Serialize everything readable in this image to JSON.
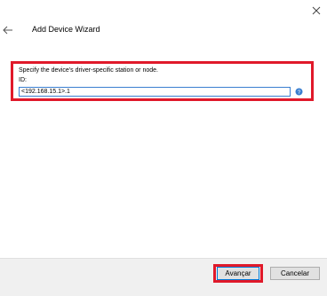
{
  "window": {
    "title": "Add Device Wizard"
  },
  "form": {
    "instruction": "Specify the device's driver-specific station or node.",
    "id_label": "ID:",
    "id_value": "<192.168.15.1>.1"
  },
  "buttons": {
    "next_label": "Avançar",
    "cancel_label": "Cancelar"
  },
  "icons": {
    "close": "close-icon",
    "back": "back-arrow-icon",
    "help": "help-icon"
  },
  "colors": {
    "highlight": "#e0192a",
    "input_border": "#3a7fd0",
    "footer_bg": "#f0f0f0"
  }
}
